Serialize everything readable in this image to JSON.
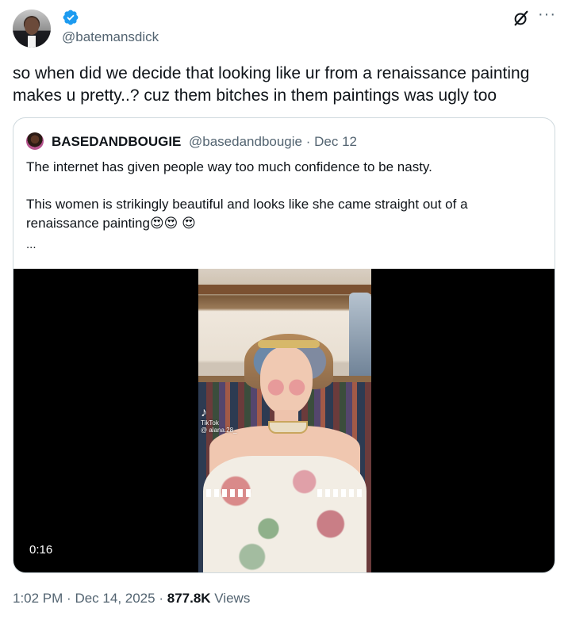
{
  "author": {
    "handle": "@batemansdick",
    "verified": true,
    "verified_color": "#1d9bf0",
    "avatar_icon": "profile-photo-man-in-suit"
  },
  "top_actions": {
    "grok_icon": "grok-slash-icon",
    "more_icon": "more-horizontal-icon",
    "more_label": "···"
  },
  "tweet": {
    "lines": [
      "so when did we decide that looking like ur from a renaissance painting",
      "makes u pretty..? cuz them bitches in them paintings was ugly too"
    ]
  },
  "quoted_tweet": {
    "display_name": "BASEDANDBOUGIE",
    "handle": "@basedandbougie",
    "separator": "·",
    "date": "Dec 12",
    "lines": [
      "The internet has given people way too much confidence to be nasty.",
      "This women is strikingly beautiful and looks like she came straight out of a",
      "renaissance painting😍😍 😍"
    ],
    "ellipsis": "...",
    "video": {
      "duration": "0:16",
      "watermark_brand": "TikTok",
      "watermark_user": "@ alana.28_"
    }
  },
  "footer": {
    "time": "1:02 PM",
    "separator": "·",
    "date": "Dec 14, 2025",
    "views_count": "877.8K",
    "views_label": "Views"
  },
  "colors": {
    "text_primary": "#0f1419",
    "text_secondary": "#536471",
    "border": "#cfd9de"
  }
}
